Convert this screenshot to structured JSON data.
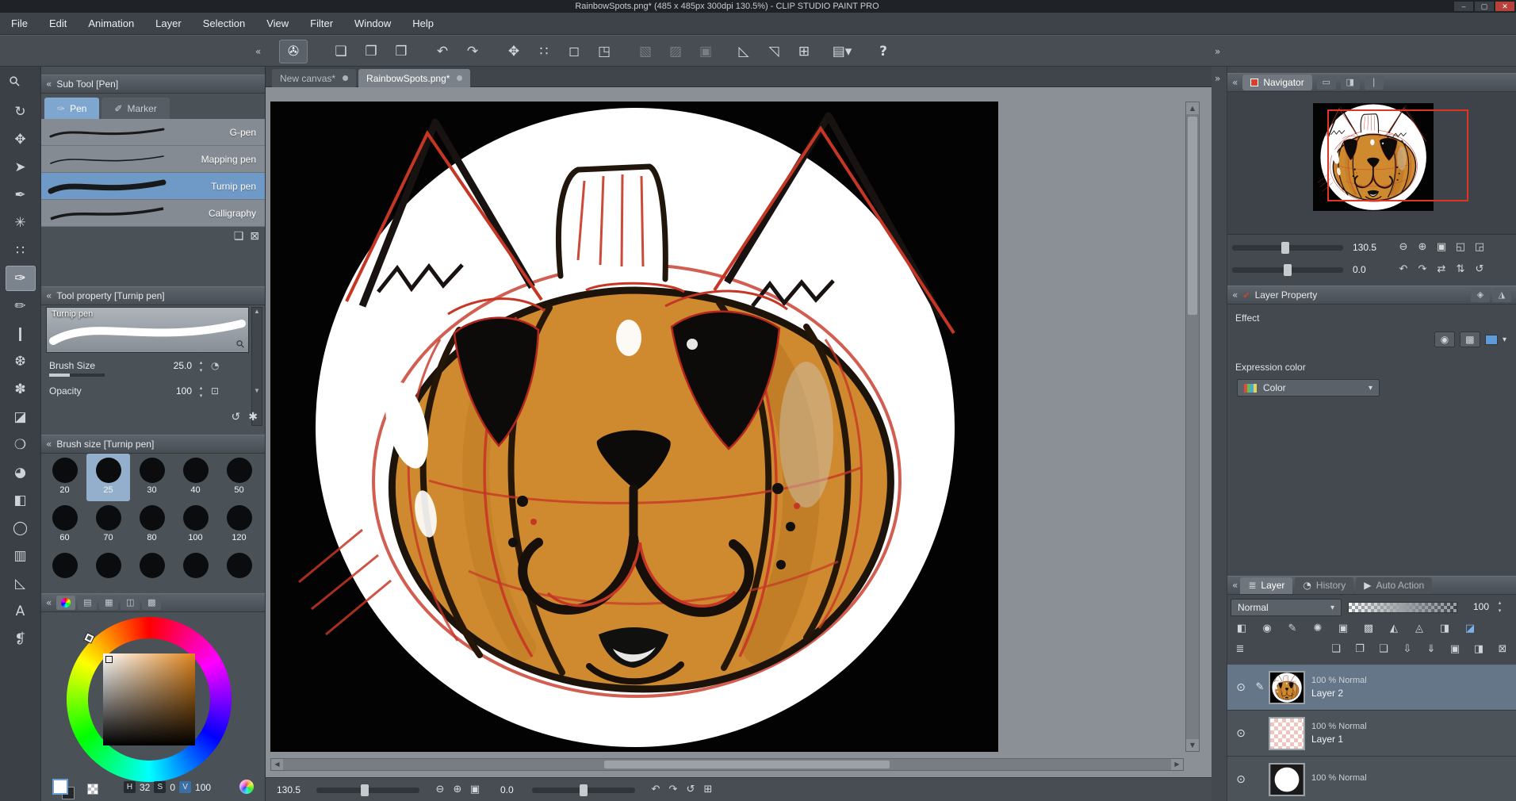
{
  "window": {
    "title": "RainbowSpots.png* (485 x 485px 300dpi 130.5%)  - CLIP STUDIO PAINT PRO",
    "minimize": "–",
    "maximize": "▢",
    "close": "✕"
  },
  "menu": {
    "items": [
      "File",
      "Edit",
      "Animation",
      "Layer",
      "Selection",
      "View",
      "Filter",
      "Window",
      "Help"
    ]
  },
  "glyphs": {
    "caret": "▾",
    "eye": "⊙",
    "edit": "✎",
    "grip_left": "«",
    "grip_right": "»",
    "up": "▲",
    "down": "▼",
    "left": "◀",
    "right": "▶",
    "check": "✔",
    "options": "≣"
  },
  "toolbar": {
    "buttons": [
      {
        "name": "clip-studio-logo",
        "glyph": "✇"
      },
      {
        "name": "new-file",
        "glyph": "❏"
      },
      {
        "name": "open-file",
        "glyph": "❐"
      },
      {
        "name": "save-file",
        "glyph": "❒"
      },
      {
        "name": "undo",
        "glyph": "↶"
      },
      {
        "name": "redo",
        "glyph": "↷"
      },
      {
        "name": "move-canvas",
        "glyph": "✥"
      },
      {
        "name": "select-area",
        "glyph": "∷"
      },
      {
        "name": "clear-selection",
        "glyph": "◻"
      },
      {
        "name": "transform",
        "glyph": "◳"
      },
      {
        "name": "expand-selection",
        "glyph": "▧"
      },
      {
        "name": "shrink-selection",
        "glyph": "▨"
      },
      {
        "name": "selection-launcher",
        "glyph": "▣"
      },
      {
        "name": "snap-to-ruler",
        "glyph": "◺"
      },
      {
        "name": "snap-to-special-ruler",
        "glyph": "◹"
      },
      {
        "name": "snap-to-grid",
        "glyph": "⊞"
      },
      {
        "name": "workspace-menu",
        "glyph": "▤▾"
      },
      {
        "name": "help",
        "glyph": "?"
      }
    ]
  },
  "tools": {
    "items": [
      {
        "name": "zoom-tool",
        "glyph": "⚲"
      },
      {
        "name": "rotate-canvas-tool",
        "glyph": "↻"
      },
      {
        "name": "move-layer-tool",
        "glyph": "✥"
      },
      {
        "name": "object-tool",
        "glyph": "➤"
      },
      {
        "name": "eyedropper-tool",
        "glyph": "✒"
      },
      {
        "name": "auto-select-tool",
        "glyph": "✳"
      },
      {
        "name": "selection-tool",
        "glyph": "∷"
      },
      {
        "name": "pen-tool",
        "glyph": "✑"
      },
      {
        "name": "pencil-tool",
        "glyph": "✏"
      },
      {
        "name": "brush-tool",
        "glyph": "❙"
      },
      {
        "name": "airbrush-tool",
        "glyph": "❆"
      },
      {
        "name": "decoration-tool",
        "glyph": "✽"
      },
      {
        "name": "eraser-tool",
        "glyph": "◪"
      },
      {
        "name": "blend-tool",
        "glyph": "❍"
      },
      {
        "name": "fill-tool",
        "glyph": "◕"
      },
      {
        "name": "gradient-tool",
        "glyph": "◧"
      },
      {
        "name": "figure-tool",
        "glyph": "◯"
      },
      {
        "name": "frame-border-tool",
        "glyph": "▥"
      },
      {
        "name": "ruler-tool",
        "glyph": "◺"
      },
      {
        "name": "text-tool",
        "glyph": "A"
      },
      {
        "name": "balloon-tool",
        "glyph": "❡"
      }
    ]
  },
  "subtool": {
    "title": "Sub Tool [Pen]",
    "tabs": [
      {
        "label": "Pen",
        "glyph": "✑"
      },
      {
        "label": "Marker",
        "glyph": "✐"
      }
    ],
    "items": [
      {
        "name": "G-pen"
      },
      {
        "name": "Mapping pen"
      },
      {
        "name": "Turnip pen"
      },
      {
        "name": "Calligraphy"
      }
    ],
    "footer_icons": [
      {
        "name": "add-subtool",
        "glyph": "❏"
      },
      {
        "name": "delete-subtool",
        "glyph": "⊠"
      }
    ]
  },
  "tool_property": {
    "title": "Tool property [Turnip pen]",
    "brush_name": "Turnip pen",
    "params": [
      {
        "label": "Brush Size",
        "value": "25.0"
      },
      {
        "label": "Opacity",
        "value": "100"
      }
    ],
    "footer_icons": [
      {
        "name": "reset-all",
        "glyph": "↺"
      },
      {
        "name": "show-sub-tool-detail",
        "glyph": "✱"
      }
    ]
  },
  "brush_size": {
    "title": "Brush size [Turnip pen]",
    "sizes": [
      {
        "label": "20"
      },
      {
        "label": "25"
      },
      {
        "label": "30"
      },
      {
        "label": "40"
      },
      {
        "label": "50"
      },
      {
        "label": "60"
      },
      {
        "label": "70"
      },
      {
        "label": "80"
      },
      {
        "label": "100"
      },
      {
        "label": "120"
      }
    ]
  },
  "color_panel": {
    "tab_icons": [
      {
        "name": "color-slider-tab",
        "glyph": "▤"
      },
      {
        "name": "color-set-tab",
        "glyph": "▦"
      },
      {
        "name": "intermediate-color-tab",
        "glyph": "◫"
      },
      {
        "name": "approx-color-tab",
        "glyph": "▩"
      }
    ],
    "hue_hex": "#e0851c",
    "hsv": [
      {
        "key": "H",
        "value": "32"
      },
      {
        "key": "S",
        "value": "0"
      },
      {
        "key": "V",
        "value": "100"
      }
    ]
  },
  "document": {
    "tabs": [
      {
        "label": "New canvas*"
      },
      {
        "label": "RainbowSpots.png*"
      }
    ]
  },
  "statusbar": {
    "zoom": "130.5",
    "rotation": "0.0",
    "zoom_icons": [
      {
        "name": "zoom-out",
        "glyph": "⊖"
      },
      {
        "name": "zoom-in",
        "glyph": "⊕"
      },
      {
        "name": "fit-to-screen",
        "glyph": "▣"
      }
    ],
    "rotate_icons": [
      {
        "name": "rotate-left",
        "glyph": "↶"
      },
      {
        "name": "rotate-right",
        "glyph": "↷"
      },
      {
        "name": "reset-rotation",
        "glyph": "↺"
      },
      {
        "name": "flip-view",
        "glyph": "⊞"
      }
    ]
  },
  "navigator": {
    "title": "Navigator",
    "zoom": "130.5",
    "rotation": "0.0",
    "tab_icons": [
      {
        "name": "sub-view-tab",
        "glyph": "▭"
      },
      {
        "name": "item-bank-tab",
        "glyph": "◨"
      },
      {
        "name": "information-tab",
        "glyph": "❘"
      }
    ],
    "zoom_icons": [
      {
        "name": "zoom-out",
        "glyph": "⊖"
      },
      {
        "name": "zoom-in",
        "glyph": "⊕"
      },
      {
        "name": "fit-to-window",
        "glyph": "▣"
      },
      {
        "name": "actual-size",
        "glyph": "◱"
      },
      {
        "name": "fit-width",
        "glyph": "◲"
      }
    ],
    "rotate_icons": [
      {
        "name": "rotate-left",
        "glyph": "↶"
      },
      {
        "name": "rotate-right",
        "glyph": "↷"
      },
      {
        "name": "flip-horizontal",
        "glyph": "⇄"
      },
      {
        "name": "flip-vertical",
        "glyph": "⇅"
      },
      {
        "name": "reset",
        "glyph": "↺"
      }
    ]
  },
  "layer_property": {
    "title": "Layer Property",
    "header_tabs": [
      {
        "name": "extra-tab-1",
        "glyph": "◈"
      },
      {
        "name": "extra-tab-2",
        "glyph": "◮"
      }
    ],
    "effect_label": "Effect",
    "effect_icons": [
      {
        "name": "border-effect",
        "glyph": "◉"
      },
      {
        "name": "tone-effect",
        "glyph": "▩"
      }
    ],
    "expression_label": "Expression color",
    "expression_value": "Color"
  },
  "layers": {
    "tabs": [
      {
        "label": "Layer",
        "glyph": "≣"
      },
      {
        "label": "History",
        "glyph": "◔"
      },
      {
        "label": "Auto Action",
        "glyph": "▶"
      }
    ],
    "blend_mode": "Normal",
    "opacity": "100",
    "tools_row1": [
      {
        "name": "layer-color-toggle",
        "glyph": "◧"
      },
      {
        "name": "show-all-layers",
        "glyph": "◉"
      },
      {
        "name": "edit-pin",
        "glyph": "✎"
      },
      {
        "name": "onion-skin",
        "glyph": "✺"
      },
      {
        "name": "lock-layer",
        "glyph": "▣"
      },
      {
        "name": "lock-transparent-pixels",
        "glyph": "▩"
      },
      {
        "name": "clip-to-layer-below",
        "glyph": "◭"
      },
      {
        "name": "set-as-reference",
        "glyph": "◬"
      },
      {
        "name": "draft-layer",
        "glyph": "◨"
      },
      {
        "name": "layer-color-chip",
        "glyph": "◪"
      }
    ],
    "tools_row2": [
      {
        "name": "new-raster-layer",
        "glyph": "❏"
      },
      {
        "name": "new-vector-layer",
        "glyph": "❐"
      },
      {
        "name": "new-layer-folder",
        "glyph": "❑"
      },
      {
        "name": "transfer-to-lower",
        "glyph": "⇩"
      },
      {
        "name": "combine-to-lower",
        "glyph": "⇓"
      },
      {
        "name": "create-layer-mask",
        "glyph": "▣"
      },
      {
        "name": "mask-to-selection",
        "glyph": "◨"
      },
      {
        "name": "delete-layer",
        "glyph": "⊠"
      }
    ],
    "items": [
      {
        "info": "100 % Normal",
        "name": "Layer 2"
      },
      {
        "info": "100 % Normal",
        "name": "Layer 1"
      },
      {
        "info": "100 % Normal",
        "name": ""
      }
    ]
  },
  "colors": {
    "accent_blue": "#6f9ac8",
    "selection_blue": "#7fa6cf",
    "sketch_red": "#c63625",
    "pumpkin_orange": "#cf8a2f",
    "canvas_black": "#030303",
    "red_frame": "#e03524"
  }
}
